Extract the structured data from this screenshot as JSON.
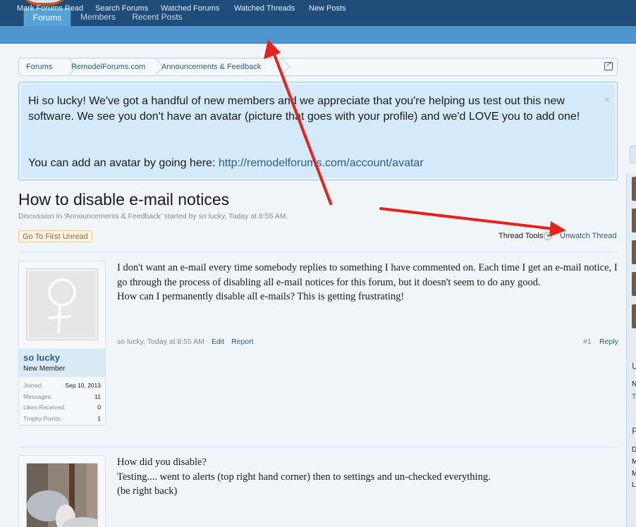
{
  "header": {
    "tabs": [
      {
        "label": "Forums"
      },
      {
        "label": "Members"
      },
      {
        "label": "Recent Posts"
      }
    ],
    "sub_links": [
      {
        "label": "Mark Forums Read"
      },
      {
        "label": "Search Forums"
      },
      {
        "label": "Watched Forums"
      },
      {
        "label": "Watched Threads"
      },
      {
        "label": "New Posts"
      }
    ]
  },
  "breadcrumb": [
    {
      "label": "Forums"
    },
    {
      "label": "RemodelForums.com"
    },
    {
      "label": "Announcements & Feedback"
    }
  ],
  "notice": {
    "line1": "Hi so lucky! We've got a handful of new members and we appreciate that you're helping us test out this new software. We see you don't have an avatar (picture that goes with your profile) and we'd LOVE you to add one!",
    "line2_prefix": "You can add an avatar by going here: ",
    "link": "http://remodelforums.com/account/avatar",
    "close": "×"
  },
  "thread": {
    "title": "How to disable e-mail notices",
    "meta": "Discussion in 'Announcements & Feedback' started by so lucky, Today at 8:55 AM.",
    "first_unread": "Go To First Unread",
    "tools": "Thread Tools",
    "unwatch": "Unwatch Thread"
  },
  "posts": [
    {
      "user": {
        "name": "so lucky",
        "title": "New Member",
        "stats": [
          {
            "label": "Joined:",
            "value": "Sep 10, 2013"
          },
          {
            "label": "Messages:",
            "value": "11"
          },
          {
            "label": "Likes Received:",
            "value": "0"
          },
          {
            "label": "Trophy Points:",
            "value": "1"
          }
        ]
      },
      "body_1": "I don't want an e-mail every time somebody replies to something I have commented on. Each time I get an e-mail notice, I go through the process of disabling all e-mail notices for this forum, but it doesn't seem to do any good.",
      "body_2": "How can I permanently disable all e-mails? This is getting frustrating!",
      "meta": "so lucky, Today at 8:55 AM",
      "edit": "Edit",
      "report": "Report",
      "number": "#1",
      "reply": "Reply"
    },
    {
      "body_1": "How did you disable?",
      "body_2": "Testing.... went to alerts (top right hand corner) then to settings and un-checked everything.",
      "body_3": "(be right back)"
    }
  ],
  "sidebar": {
    "letters": [
      "U",
      "N",
      "T",
      "F",
      "D",
      "M",
      "M",
      "L"
    ]
  },
  "colors": {
    "header": "#1f4c78",
    "subnav": "#4d96cf",
    "notice": "#d4eafa",
    "link": "#2b5c87",
    "annotation_arrow": "#e8201e"
  }
}
